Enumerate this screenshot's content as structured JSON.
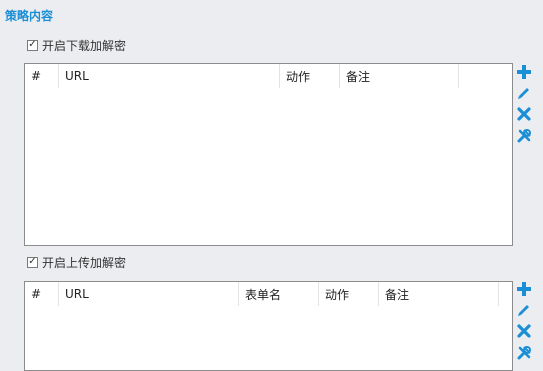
{
  "section_title": "策略内容",
  "download": {
    "checkbox_label": "开启下载加解密",
    "checked": true,
    "columns": [
      "#",
      "URL",
      "动作",
      "备注"
    ]
  },
  "upload": {
    "checkbox_label": "开启上传加解密",
    "checked": true,
    "columns": [
      "#",
      "URL",
      "表单名",
      "动作",
      "备注"
    ]
  },
  "toolbar": {
    "icons": [
      "add-icon",
      "edit-icon",
      "delete-icon",
      "settings-icon"
    ],
    "color": "#1a8fd6"
  }
}
